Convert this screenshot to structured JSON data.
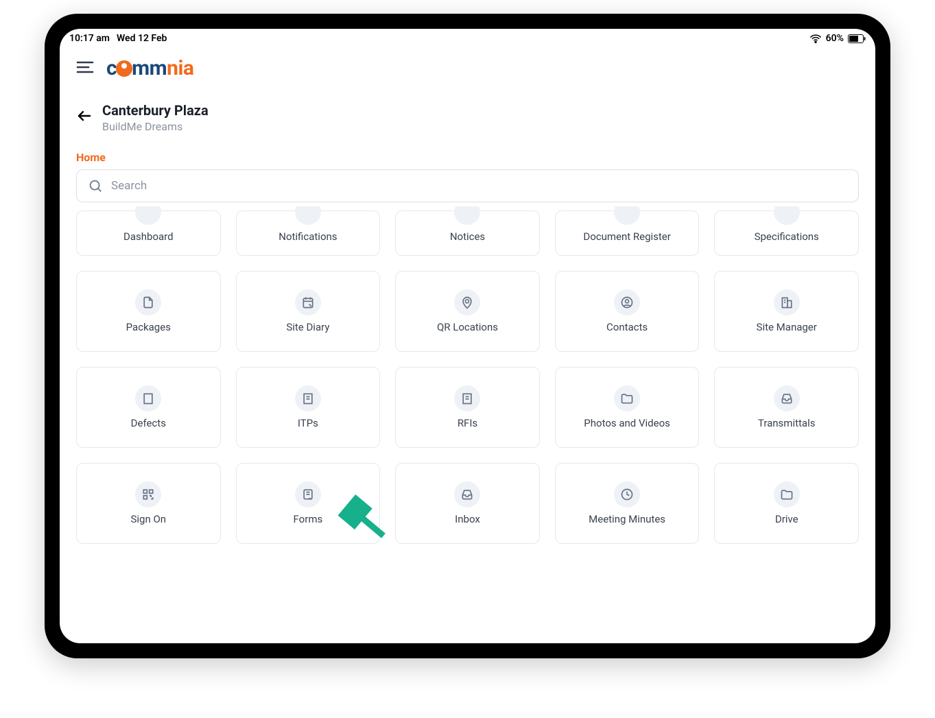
{
  "status": {
    "time": "10:17 am",
    "date": "Wed 12 Feb",
    "battery_pct": "60%"
  },
  "logo": {
    "c": "c",
    "mm": "mm",
    "nia": "nia"
  },
  "project": {
    "title": "Canterbury Plaza",
    "subtitle": "BuildMe Dreams"
  },
  "home_label": "Home",
  "search": {
    "placeholder": "Search"
  },
  "tiles": {
    "row0": [
      {
        "label": "Dashboard"
      },
      {
        "label": "Notifications"
      },
      {
        "label": "Notices"
      },
      {
        "label": "Document Register"
      },
      {
        "label": "Specifications"
      }
    ],
    "row1": [
      {
        "label": "Packages",
        "icon": "file"
      },
      {
        "label": "Site Diary",
        "icon": "calendar-edit"
      },
      {
        "label": "QR Locations",
        "icon": "pin"
      },
      {
        "label": "Contacts",
        "icon": "user-circle"
      },
      {
        "label": "Site Manager",
        "icon": "building"
      }
    ],
    "row2": [
      {
        "label": "Defects",
        "icon": "building"
      },
      {
        "label": "ITPs",
        "icon": "building"
      },
      {
        "label": "RFIs",
        "icon": "building"
      },
      {
        "label": "Photos and Videos",
        "icon": "folder"
      },
      {
        "label": "Transmittals",
        "icon": "inbox"
      }
    ],
    "row3": [
      {
        "label": "Sign On",
        "icon": "qr"
      },
      {
        "label": "Forms",
        "icon": "form"
      },
      {
        "label": "Inbox",
        "icon": "inbox"
      },
      {
        "label": "Meeting Minutes",
        "icon": "clock"
      },
      {
        "label": "Drive",
        "icon": "folder"
      }
    ]
  }
}
